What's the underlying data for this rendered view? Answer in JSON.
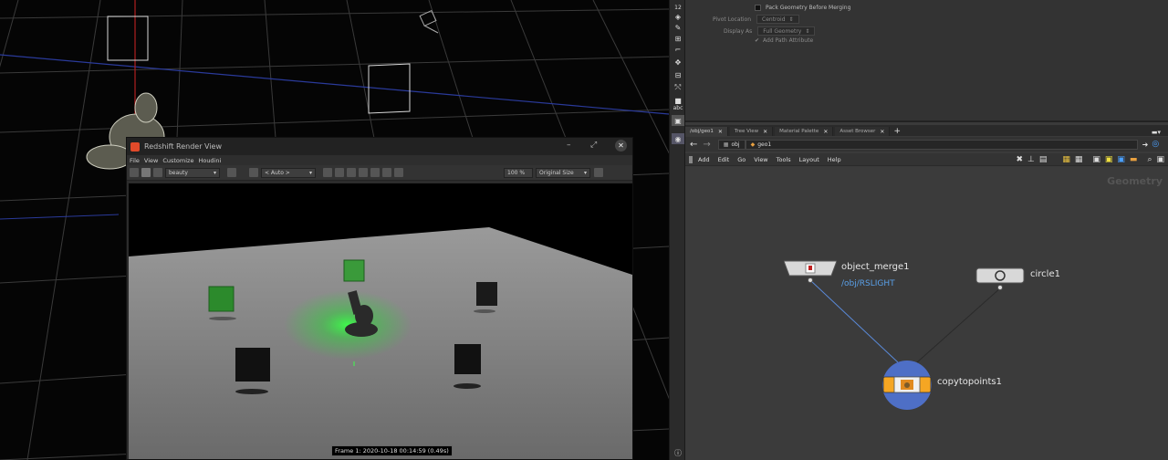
{
  "params": {
    "pack_geometry_label": "Pack Geometry Before Merging",
    "pivot_location_label": "Pivot Location",
    "pivot_location_value": "Centroid",
    "display_as_label": "Display As",
    "display_as_value": "Full Geometry",
    "add_path_attribute_label": "Add Path Attribute"
  },
  "tabs": [
    "/obj/geo1",
    "Tree View",
    "Material Palette",
    "Asset Browser"
  ],
  "path": {
    "root": "obj",
    "node": "geo1"
  },
  "network_menu": [
    "Add",
    "Edit",
    "Go",
    "View",
    "Tools",
    "Layout",
    "Help"
  ],
  "network": {
    "context_label": "Geometry",
    "nodes": {
      "object_merge": {
        "name": "object_merge1",
        "subtitle": "/obj/RSLIGHT"
      },
      "circle": {
        "name": "circle1"
      },
      "copytopoints": {
        "name": "copytopoints1"
      }
    }
  },
  "shelf": {
    "top_number": "12",
    "text_tool": "abc"
  },
  "render_view": {
    "title": "Redshift Render View",
    "menu": [
      "File",
      "View",
      "Customize",
      "Houdini"
    ],
    "aov": "beauty",
    "camera": "< Auto >",
    "zoom": "100 %",
    "size_mode": "Original Size",
    "frame_info": "Frame 1: 2020-10-18  00:14:59  (0.49s)"
  },
  "colors": {
    "node_blue": "#5aa0e8",
    "copytopoints_orange": "#f5a623",
    "copytopoints_ring": "#4e6fc6",
    "green_light": "#2fd43a"
  }
}
